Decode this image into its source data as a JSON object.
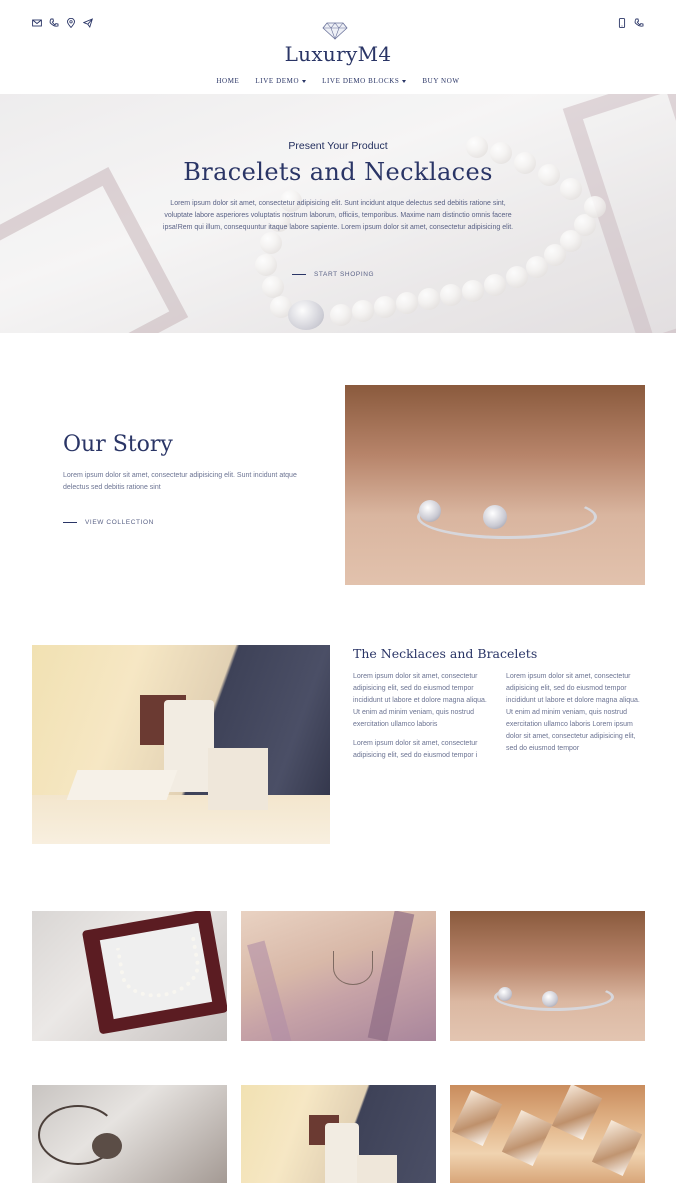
{
  "header": {
    "contact_icons": [
      "mail-icon",
      "phone-icon",
      "location-icon",
      "send-icon"
    ],
    "device_icons": [
      "mobile-icon",
      "phone-icon"
    ],
    "logo_text": "LuxuryM4",
    "logo_icon": "diamond-icon",
    "nav": [
      {
        "label": "HOME",
        "dropdown": false
      },
      {
        "label": "LIVE DEMO",
        "dropdown": true
      },
      {
        "label": "LIVE DEMO BLOCKS",
        "dropdown": true
      },
      {
        "label": "BUY NOW",
        "dropdown": false
      }
    ]
  },
  "hero": {
    "subtitle": "Present Your Product",
    "title": "Bracelets and Necklaces",
    "text": "Lorem ipsum dolor sit amet, consectetur adipisicing elit. Sunt incidunt atque delectus sed debitis ratione sint, voluptate labore asperiores voluptatis nostrum laborum, officiis, temporibus. Maxime nam distinctio omnis facere ipsa!Rem qui illum, consequuntur itaque labore sapiente. Lorem ipsum dolor sit amet, consectetur adipisicing elit.",
    "cta": "START SHOPING"
  },
  "story": {
    "title": "Our Story",
    "text": "Lorem ipsum dolor sit amet, consectetur adipisicing elit. Sunt incidunt atque delectus sed debitis ratione sint",
    "cta": "VIEW COLLECTION"
  },
  "necklaces": {
    "title": "The Necklaces and Bracelets",
    "col1_p1": "Lorem ipsum dolor sit amet, consectetur adipisicing elit, sed do eiusmod tempor incididunt ut labore et dolore magna aliqua. Ut enim ad minim veniam, quis nostrud exercitation ullamco laboris",
    "col1_p2": "Lorem ipsum dolor sit amet, consectetur adipisicing elit, sed do eiusmod tempor i",
    "col2": "Lorem ipsum dolor sit amet, consectetur adipisicing elit, sed do eiusmod tempor incididunt ut labore et dolore magna aliqua. Ut enim ad minim veniam, quis nostrud exercitation ullamco laboris Lorem ipsum dolor sit amet, consectetur adipisicing elit, sed do eiusmod tempor"
  },
  "colors": {
    "primary": "#2a3566",
    "muted_text": "#6b7392",
    "background": "#ffffff"
  }
}
